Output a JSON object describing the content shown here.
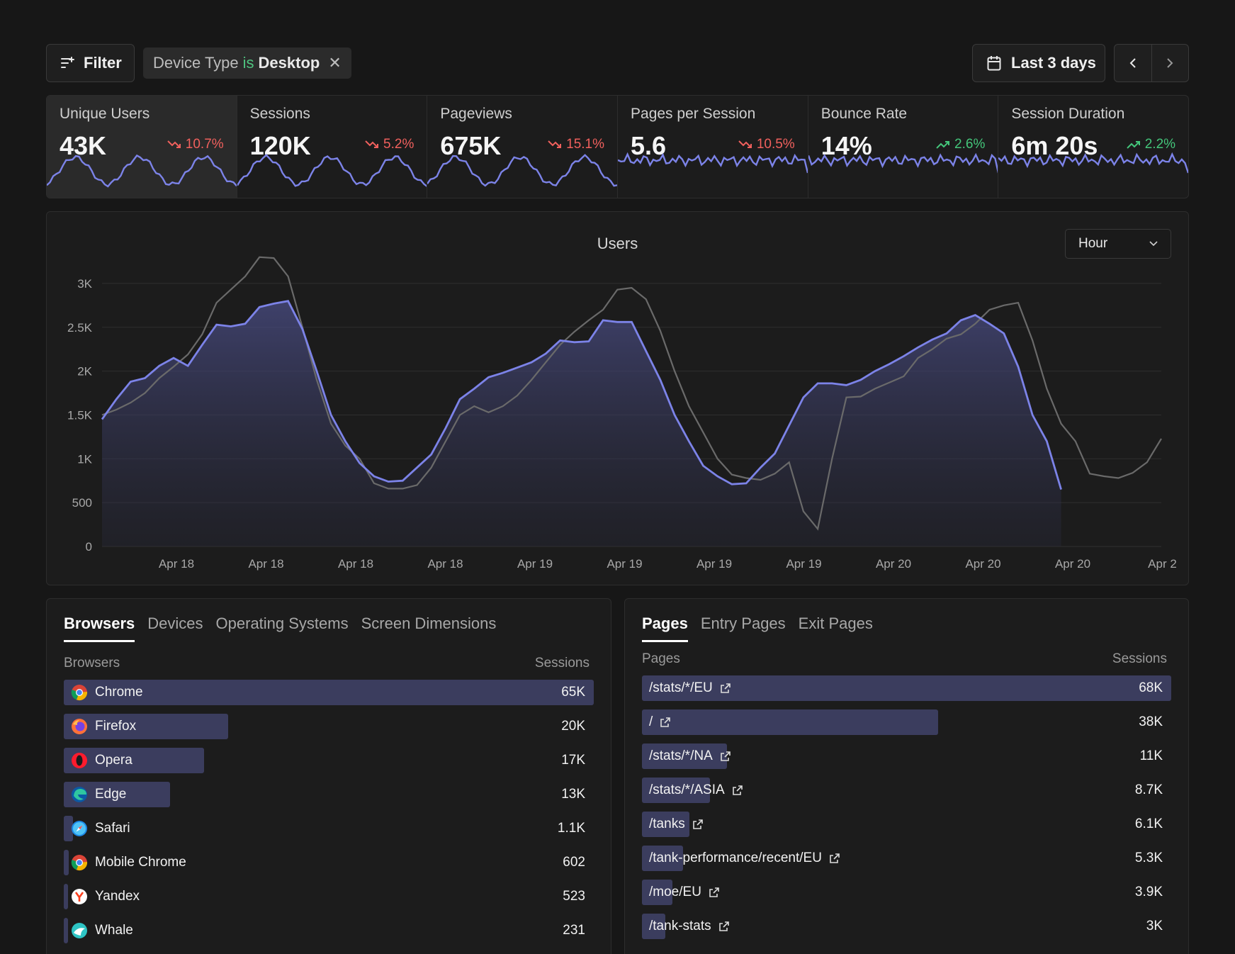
{
  "toolbar": {
    "filter_label": "Filter",
    "chip": {
      "field": "Device Type",
      "operator": "is",
      "value": "Desktop"
    },
    "date_range": "Last 3 days"
  },
  "stats": [
    {
      "label": "Unique Users",
      "value": "43K",
      "change": "10.7%",
      "direction": "down",
      "active": true
    },
    {
      "label": "Sessions",
      "value": "120K",
      "change": "5.2%",
      "direction": "down"
    },
    {
      "label": "Pageviews",
      "value": "675K",
      "change": "15.1%",
      "direction": "down"
    },
    {
      "label": "Pages per Session",
      "value": "5.6",
      "change": "10.5%",
      "direction": "down"
    },
    {
      "label": "Bounce Rate",
      "value": "14%",
      "change": "2.6%",
      "direction": "up"
    },
    {
      "label": "Session Duration",
      "value": "6m 20s",
      "change": "2.2%",
      "direction": "up"
    }
  ],
  "chart": {
    "title": "Users",
    "granularity": "Hour"
  },
  "chart_data": {
    "type": "area",
    "title": "Users",
    "yticks": [
      "0",
      "500",
      "1K",
      "1.5K",
      "2K",
      "2.5K",
      "3K"
    ],
    "ylim": [
      0,
      3250
    ],
    "xtick_labels": [
      "Apr 18",
      "Apr 18",
      "Apr 18",
      "Apr 18",
      "Apr 19",
      "Apr 19",
      "Apr 19",
      "Apr 19",
      "Apr 20",
      "Apr 20",
      "Apr 20",
      "Apr 2"
    ],
    "series": [
      {
        "role": "current",
        "color": "#7c83e8",
        "values": [
          1450,
          1680,
          1880,
          1920,
          2060,
          2150,
          2060,
          2300,
          2530,
          2510,
          2540,
          2730,
          2770,
          2800,
          2480,
          2000,
          1500,
          1200,
          950,
          800,
          740,
          750,
          900,
          1050,
          1350,
          1680,
          1800,
          1930,
          1980,
          2040,
          2100,
          2200,
          2350,
          2330,
          2340,
          2580,
          2560,
          2560,
          2230,
          1900,
          1500,
          1200,
          920,
          800,
          710,
          720,
          900,
          1060,
          1380,
          1700,
          1860,
          1860,
          1840,
          1900,
          2000,
          2080,
          2170,
          2270,
          2360,
          2430,
          2580,
          2640,
          2540,
          2430,
          2050,
          1500,
          1200,
          650
        ]
      },
      {
        "role": "previous",
        "color": "#6a6a6a",
        "values": [
          1500,
          1560,
          1640,
          1750,
          1920,
          2050,
          2190,
          2420,
          2780,
          2930,
          3080,
          3300,
          3290,
          3080,
          2500,
          1900,
          1400,
          1150,
          1000,
          720,
          660,
          660,
          700,
          900,
          1200,
          1500,
          1600,
          1530,
          1600,
          1720,
          1900,
          2100,
          2300,
          2450,
          2580,
          2700,
          2930,
          2950,
          2820,
          2460,
          2000,
          1600,
          1300,
          1000,
          820,
          780,
          760,
          830,
          960,
          400,
          200,
          1000,
          1700,
          1710,
          1800,
          1870,
          1940,
          2150,
          2250,
          2370,
          2420,
          2540,
          2700,
          2750,
          2780,
          2350,
          1800,
          1400,
          1200,
          830,
          800,
          780,
          840,
          960,
          1230
        ]
      }
    ]
  },
  "browsers_panel": {
    "tabs": [
      "Browsers",
      "Devices",
      "Operating Systems",
      "Screen Dimensions"
    ],
    "col_label": "Browsers",
    "col_value": "Sessions",
    "rows": [
      {
        "label": "Chrome",
        "value": "65K",
        "icon": "chrome-icon",
        "fraction": 1.0
      },
      {
        "label": "Firefox",
        "value": "20K",
        "icon": "firefox-icon",
        "fraction": 0.31
      },
      {
        "label": "Opera",
        "value": "17K",
        "icon": "opera-icon",
        "fraction": 0.265
      },
      {
        "label": "Edge",
        "value": "13K",
        "icon": "edge-icon",
        "fraction": 0.2
      },
      {
        "label": "Safari",
        "value": "1.1K",
        "icon": "safari-icon",
        "fraction": 0.017
      },
      {
        "label": "Mobile Chrome",
        "value": "602",
        "icon": "chrome-icon",
        "fraction": 0.009
      },
      {
        "label": "Yandex",
        "value": "523",
        "icon": "yandex-icon",
        "fraction": 0.008
      },
      {
        "label": "Whale",
        "value": "231",
        "icon": "whale-icon",
        "fraction": 0.004
      }
    ]
  },
  "pages_panel": {
    "tabs": [
      "Pages",
      "Entry Pages",
      "Exit Pages"
    ],
    "col_label": "Pages",
    "col_value": "Sessions",
    "rows": [
      {
        "label": "/stats/*/EU",
        "value": "68K",
        "fraction": 1.0
      },
      {
        "label": "/",
        "value": "38K",
        "fraction": 0.56
      },
      {
        "label": "/stats/*/NA",
        "value": "11K",
        "fraction": 0.16
      },
      {
        "label": "/stats/*/ASIA",
        "value": "8.7K",
        "fraction": 0.128
      },
      {
        "label": "/tanks",
        "value": "6.1K",
        "fraction": 0.09
      },
      {
        "label": "/tank-performance/recent/EU",
        "value": "5.3K",
        "fraction": 0.078
      },
      {
        "label": "/moe/EU",
        "value": "3.9K",
        "fraction": 0.057
      },
      {
        "label": "/tank-stats",
        "value": "3K",
        "fraction": 0.044
      }
    ]
  }
}
